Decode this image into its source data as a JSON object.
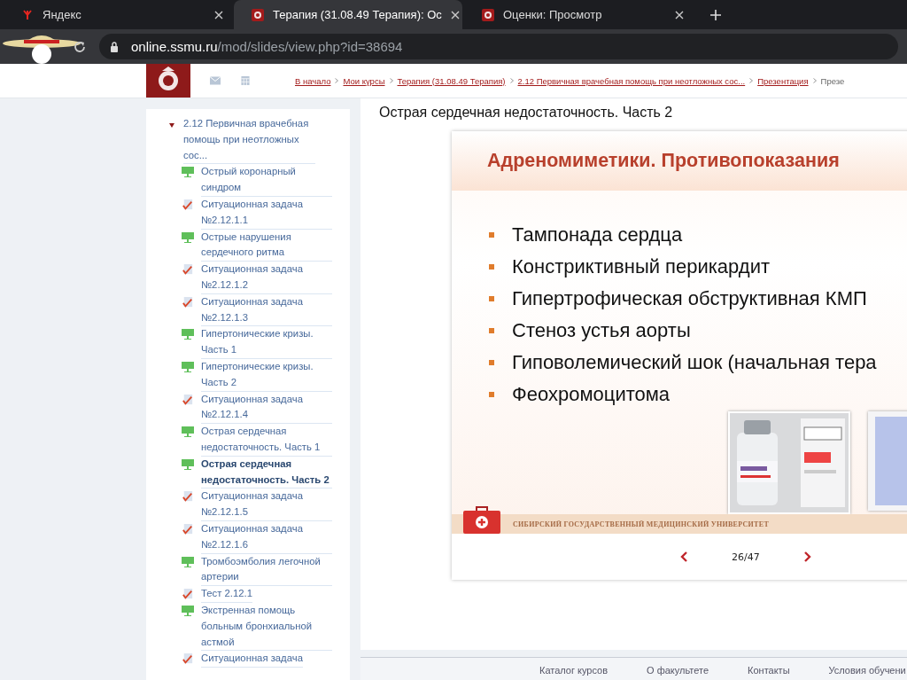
{
  "browser": {
    "tabs": [
      {
        "title": "Яндекс",
        "kind": "yandex",
        "selected": false
      },
      {
        "title": "Терапия (31.08.49 Терапия): Ос",
        "kind": "crest",
        "selected": true
      },
      {
        "title": "Оценки: Просмотр",
        "kind": "crest",
        "selected": false
      }
    ],
    "address": {
      "host": "online.ssmu.ru",
      "path": "/mod/slides/view.php?id=38694"
    }
  },
  "breadcrumbs": [
    "В начало",
    "Мои курсы",
    "Терапия (31.08.49 Терапия)",
    "2.12 Первичная врачебная помощь при неотложных сос...",
    "Презентация",
    "Презе"
  ],
  "sidebar": {
    "section": {
      "title": "2.12 Первичная врачебная помощь при неотложных сос...",
      "expanded": true,
      "children": [
        {
          "label": "Острый коронарный синдром",
          "kind": "slides",
          "selected": false
        },
        {
          "label": "Ситуационная задача №2.12.1.1",
          "kind": "quiz",
          "selected": false
        },
        {
          "label": "Острые нарушения сердечного ритма",
          "kind": "slides",
          "selected": false
        },
        {
          "label": "Ситуационная задача №2.12.1.2",
          "kind": "quiz",
          "selected": false
        },
        {
          "label": "Ситуационная задача №2.12.1.3",
          "kind": "quiz",
          "selected": false
        },
        {
          "label": "Гипертонические кризы. Часть 1",
          "kind": "slides",
          "selected": false
        },
        {
          "label": "Гипертонические кризы. Часть 2",
          "kind": "slides",
          "selected": false
        },
        {
          "label": "Ситуационная задача №2.12.1.4",
          "kind": "quiz",
          "selected": false
        },
        {
          "label": "Острая сердечная недостаточность. Часть 1",
          "kind": "slides",
          "selected": false
        },
        {
          "label": "Острая сердечная недостаточность. Часть 2",
          "kind": "slides",
          "selected": true
        },
        {
          "label": "Ситуационная задача №2.12.1.5",
          "kind": "quiz",
          "selected": false
        },
        {
          "label": "Ситуационная задача №2.12.1.6",
          "kind": "quiz",
          "selected": false
        },
        {
          "label": "Тромбоэмболия легочной артерии",
          "kind": "slides",
          "selected": false
        },
        {
          "label": "Тест 2.12.1",
          "kind": "quiz",
          "selected": false
        },
        {
          "label": "Экстренная помощь больным бронхиальной астмой",
          "kind": "slides",
          "selected": false
        },
        {
          "label": "Ситуационная задача",
          "kind": "quiz",
          "selected": false
        }
      ]
    }
  },
  "main": {
    "title": "Острая сердечная недостаточность. Часть 2",
    "slide": {
      "heading": "Адреномиметики. Противопоказания",
      "bullets": [
        "Тампонада сердца",
        "Констриктивный перикардит",
        "Гипертрофическая обструктивная КМП",
        "Стеноз устья аорты",
        "Гиповолемический шок (начальная тера",
        "Феохромоцитома"
      ],
      "footer": "СИБИРСКИЙ ГОСУДАРСТВЕННЫЙ МЕДИЦИНСКИЙ УНИВЕРСИТЕТ"
    },
    "pager": "26/47"
  },
  "footer_links": [
    "Каталог курсов",
    "О факультете",
    "Контакты",
    "Условия обучени"
  ]
}
